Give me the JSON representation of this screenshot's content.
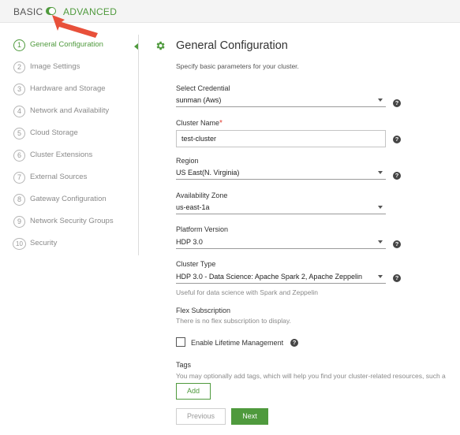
{
  "mode": {
    "basic": "BASIC",
    "advanced": "ADVANCED",
    "toggle_on": true
  },
  "sidebar": {
    "items": [
      {
        "num": "1",
        "label": "General Configuration",
        "active": true
      },
      {
        "num": "2",
        "label": "Image Settings"
      },
      {
        "num": "3",
        "label": "Hardware and Storage"
      },
      {
        "num": "4",
        "label": "Network and Availability"
      },
      {
        "num": "5",
        "label": "Cloud Storage"
      },
      {
        "num": "6",
        "label": "Cluster Extensions"
      },
      {
        "num": "7",
        "label": "External Sources"
      },
      {
        "num": "8",
        "label": "Gateway Configuration"
      },
      {
        "num": "9",
        "label": "Network Security Groups"
      },
      {
        "num": "10",
        "label": "Security"
      }
    ]
  },
  "form": {
    "icon": "gear-icon",
    "title": "General Configuration",
    "subtitle": "Specify basic parameters for your cluster.",
    "credential": {
      "label": "Select Credential",
      "value": "sunman (Aws)"
    },
    "cluster_name": {
      "label": "Cluster Name",
      "required": "*",
      "value": "test-cluster"
    },
    "region": {
      "label": "Region",
      "value": "US East(N. Virginia)"
    },
    "availability_zone": {
      "label": "Availability Zone",
      "value": "us-east-1a"
    },
    "platform_version": {
      "label": "Platform Version",
      "value": "HDP 3.0"
    },
    "cluster_type": {
      "label": "Cluster Type",
      "value": "HDP 3.0 - Data Science: Apache Spark 2, Apache Zeppelin",
      "hint": "Useful for data science with Spark and Zeppelin"
    },
    "flex": {
      "label": "Flex Subscription",
      "hint": "There is no flex subscription to display."
    },
    "lifetime": {
      "label": "Enable Lifetime Management",
      "checked": false
    },
    "tags": {
      "label": "Tags",
      "hint": "You may optionally add tags, which will help you find your cluster-related resources, such a",
      "add_label": "Add"
    },
    "help_glyph": "?"
  },
  "footer": {
    "previous_label": "Previous",
    "next_label": "Next"
  },
  "colors": {
    "accent": "#4f9a3d",
    "required": "#e03c31",
    "arrow": "#e8503a"
  }
}
